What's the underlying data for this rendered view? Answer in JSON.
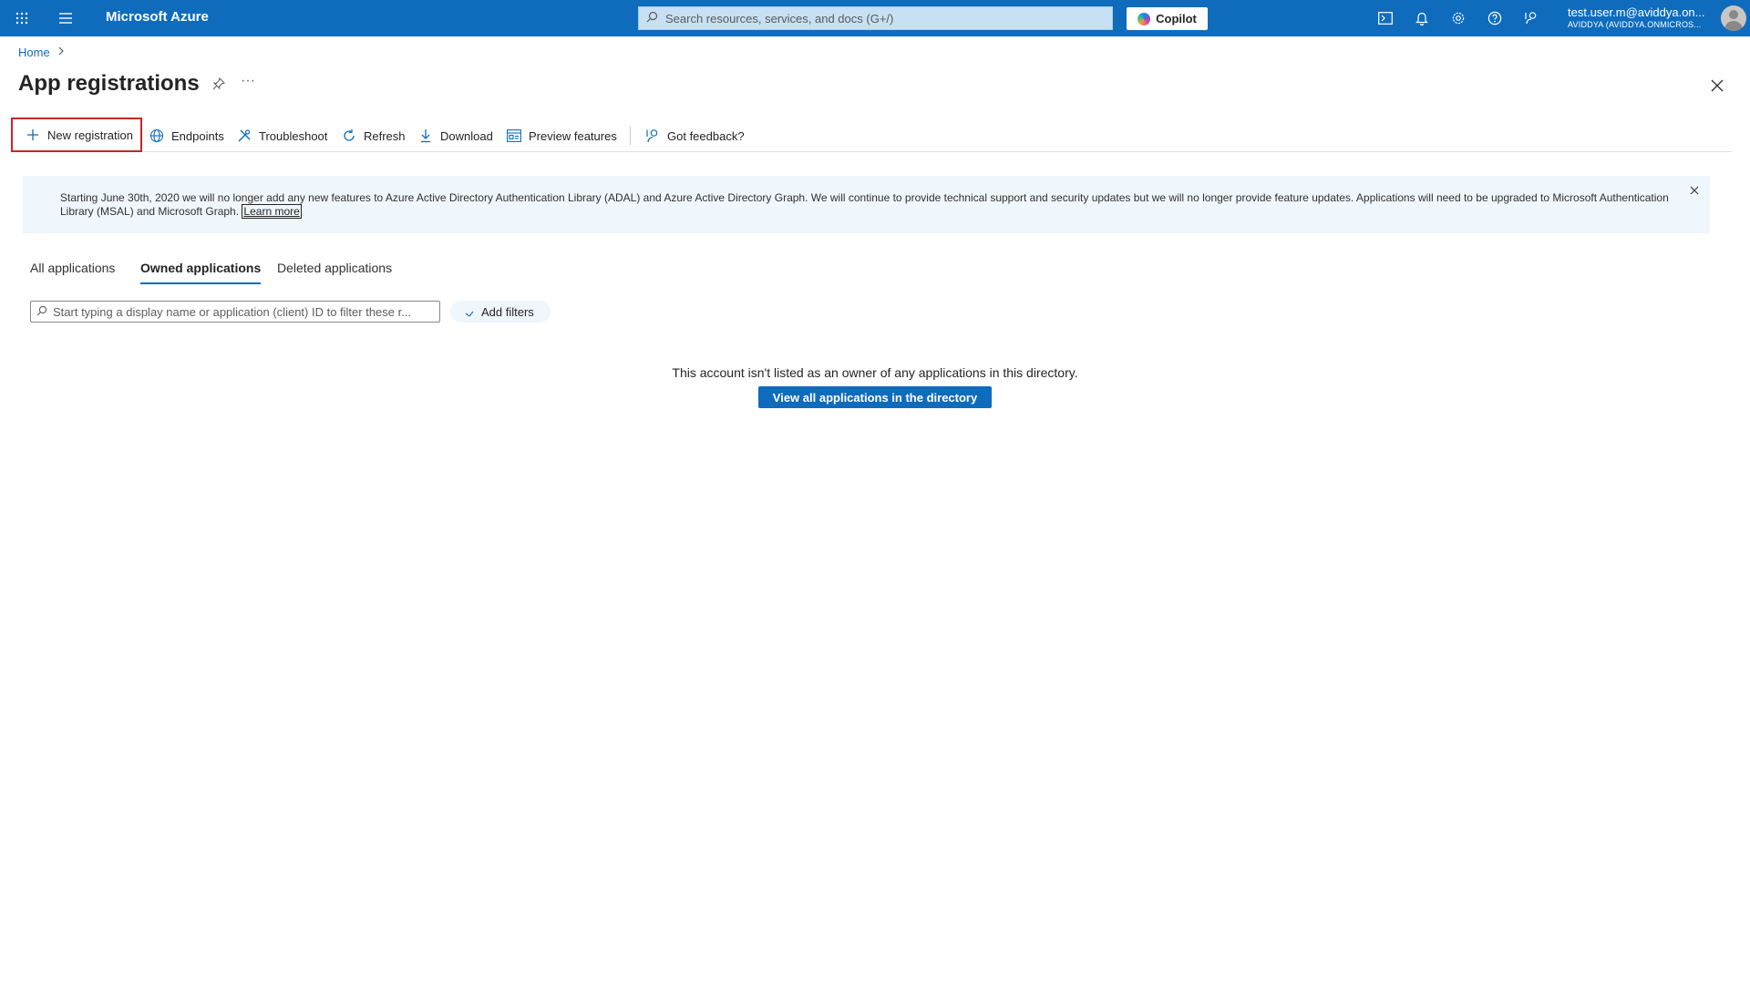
{
  "topbar": {
    "brand": "Microsoft Azure",
    "search_placeholder": "Search resources, services, and docs (G+/)",
    "copilot_label": "Copilot",
    "account_user": "test.user.m@aviddya.on...",
    "account_tenant": "AVIDDYA (AVIDDYA.ONMICROS...",
    "icons": [
      "waffle-icon",
      "hamburger-icon",
      "cloud-shell-icon",
      "bell-icon",
      "gear-icon",
      "help-icon",
      "feedback-icon"
    ],
    "color": "#0f6cbd"
  },
  "breadcrumb": {
    "home": "Home"
  },
  "page": {
    "title": "App registrations",
    "more": "···"
  },
  "commands": {
    "new_registration": "New registration",
    "endpoints": "Endpoints",
    "troubleshoot": "Troubleshoot",
    "refresh": "Refresh",
    "download": "Download",
    "preview_features": "Preview features",
    "feedback": "Got feedback?"
  },
  "banner": {
    "text": "Starting June 30th, 2020 we will no longer add any new features to Azure Active Directory Authentication Library (ADAL) and Azure Active Directory Graph. We will continue to provide technical support and security updates but we will no longer provide feature updates. Applications will need to be upgraded to Microsoft Authentication Library (MSAL) and Microsoft Graph.",
    "link": "Learn more"
  },
  "tabs": {
    "all": "All applications",
    "owned": "Owned applications",
    "deleted": "Deleted applications",
    "active": "owned"
  },
  "filter": {
    "placeholder": "Start typing a display name or application (client) ID to filter these r...",
    "add_filters": "Add filters"
  },
  "empty_state": {
    "message": "This account isn't listed as an owner of any applications in this directory.",
    "button": "View all applications in the directory"
  }
}
